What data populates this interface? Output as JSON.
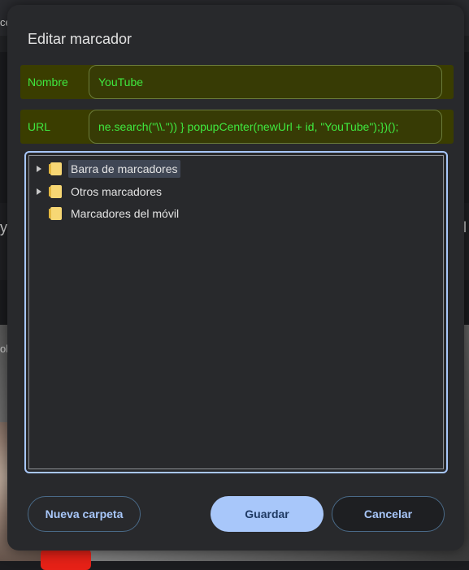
{
  "background": {
    "left_fragments": [
      "ce",
      "y",
      "ol"
    ],
    "right_fragments": [
      "l"
    ]
  },
  "dialog": {
    "title": "Editar marcador",
    "name_label": "Nombre",
    "name_value": "YouTube",
    "url_label": "URL",
    "url_value": "ne.search(\"\\\\.\"))    }    popupCenter(newUrl + id, \"YouTube\");})();",
    "tree": [
      {
        "label": "Barra de marcadores",
        "expandable": true,
        "selected": true
      },
      {
        "label": "Otros marcadores",
        "expandable": true,
        "selected": false
      },
      {
        "label": "Marcadores del móvil",
        "expandable": false,
        "selected": false
      }
    ],
    "buttons": {
      "new_folder": "Nueva carpeta",
      "save": "Guardar",
      "cancel": "Cancelar"
    }
  }
}
